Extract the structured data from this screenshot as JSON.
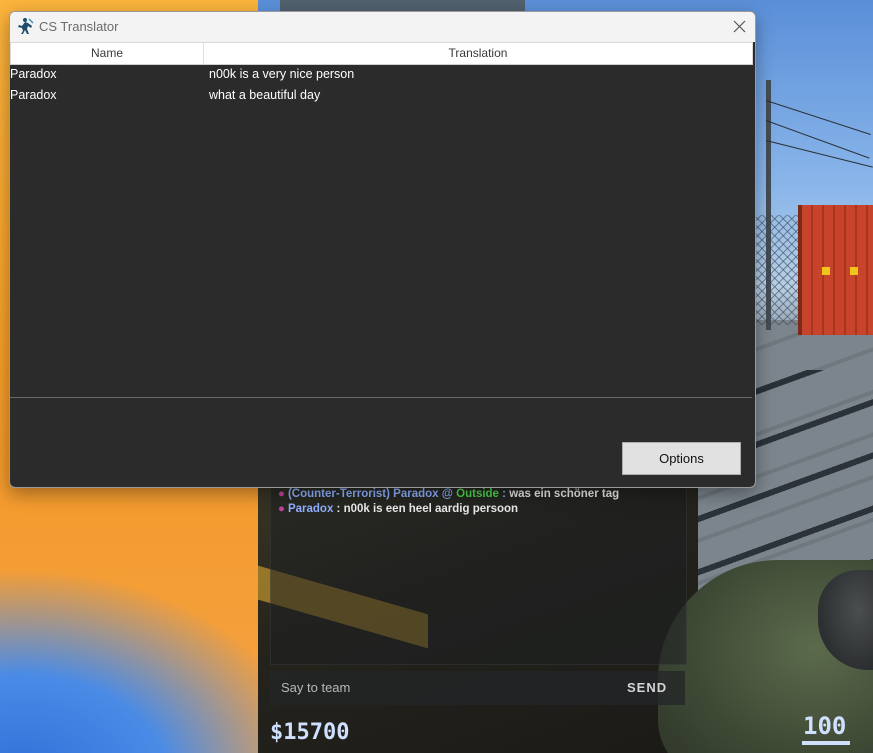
{
  "window": {
    "title": "CS Translator"
  },
  "table": {
    "columns": [
      "Name",
      "Translation"
    ],
    "rows": [
      {
        "name": "Paradox",
        "translation": "n00k is a very nice person"
      },
      {
        "name": "Paradox",
        "translation": "what a beautiful day"
      }
    ]
  },
  "buttons": {
    "options_label": "Options"
  },
  "game_chat": {
    "lines": [
      {
        "team_prefix": "(Counter-Terrorist) Paradox @ ",
        "location": "Outside",
        "separator": " :  ",
        "message": "was ein schöner tag"
      },
      {
        "team_prefix": "Paradox",
        "location": "",
        "separator": " : ",
        "message": "n00k is een heel aardig persoon"
      }
    ],
    "input_placeholder": "Say to team",
    "send_label": "SEND"
  },
  "hud": {
    "money": "$15700",
    "health": "100"
  },
  "colors": {
    "table_bg": "#2b2b2b",
    "chat_team": "#8fb0ff",
    "chat_location": "#4cd84c",
    "hud_text": "#cfe0ff"
  }
}
